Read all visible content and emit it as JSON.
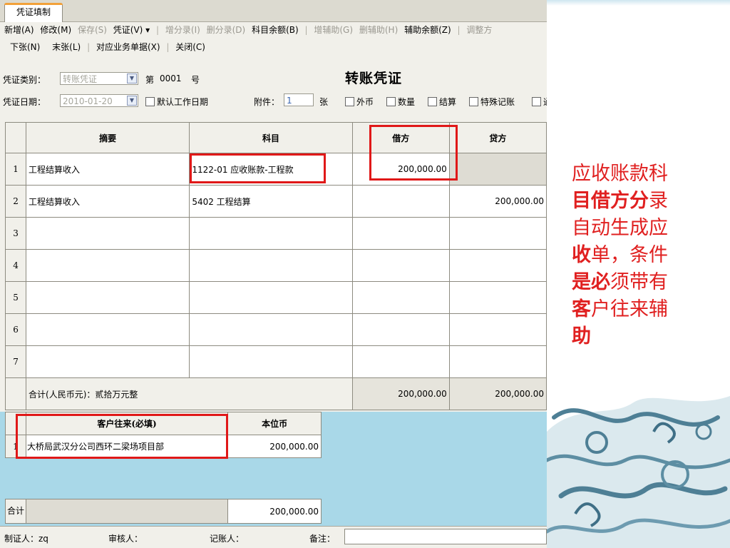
{
  "tab": {
    "label": "凭证填制"
  },
  "menu1": [
    {
      "label": "新增(A)",
      "enabled": true
    },
    {
      "label": "修改(M)",
      "enabled": true
    },
    {
      "label": "保存(S)",
      "enabled": false
    },
    {
      "label": "凭证(V) ▾",
      "enabled": true
    },
    {
      "label": "增分录(I)",
      "enabled": false
    },
    {
      "label": "删分录(D)",
      "enabled": false
    },
    {
      "label": "科目余额(B)",
      "enabled": true
    },
    {
      "label": "增辅助(G)",
      "enabled": false
    },
    {
      "label": "删辅助(H)",
      "enabled": false
    },
    {
      "label": "辅助余额(Z)",
      "enabled": true
    },
    {
      "label": "调整方",
      "enabled": false
    }
  ],
  "menu2": [
    {
      "label": "下张(N)"
    },
    {
      "label": "末张(L)"
    },
    {
      "label": "对应业务单据(X)"
    },
    {
      "label": "关闭(C)"
    }
  ],
  "form": {
    "type_label": "凭证类别：",
    "type_value": "转账凭证",
    "no_prefix": "第",
    "no_value": "0001",
    "no_suffix": "号",
    "title": "转账凭证",
    "date_label": "凭证日期：",
    "date_value": "2010-01-20",
    "default_date": "默认工作日期",
    "attach_label": "附件：",
    "attach_value": "1",
    "attach_unit": "张",
    "checks": [
      "外币",
      "数量",
      "结算",
      "特殊记账",
      "通"
    ]
  },
  "voucher": {
    "headers": {
      "summary": "摘要",
      "account": "科目",
      "debit": "借方",
      "credit": "贷方"
    },
    "rows": [
      {
        "no": "1",
        "summary": "工程结算收入",
        "account": "1122-01 应收账款-工程款",
        "debit": "200,000.00",
        "credit": ""
      },
      {
        "no": "2",
        "summary": "工程结算收入",
        "account": "5402 工程结算",
        "debit": "",
        "credit": "200,000.00"
      },
      {
        "no": "3",
        "summary": "",
        "account": "",
        "debit": "",
        "credit": ""
      },
      {
        "no": "4",
        "summary": "",
        "account": "",
        "debit": "",
        "credit": ""
      },
      {
        "no": "5",
        "summary": "",
        "account": "",
        "debit": "",
        "credit": ""
      },
      {
        "no": "6",
        "summary": "",
        "account": "",
        "debit": "",
        "credit": ""
      },
      {
        "no": "7",
        "summary": "",
        "account": "",
        "debit": "",
        "credit": ""
      }
    ],
    "total_label": "合计(人民币元)：贰拾万元整",
    "total_debit": "200,000.00",
    "total_credit": "200,000.00"
  },
  "aux": {
    "headers": {
      "customer": "客户往来(必填)",
      "amount": "本位币"
    },
    "rows": [
      {
        "no": "1",
        "customer": "大桥局武汉分公司西环二梁场项目部",
        "amount": "200,000.00"
      }
    ],
    "total_label": "合计",
    "total_amount": "200,000.00"
  },
  "status": {
    "maker": "制证人：zq",
    "auditor": "审核人：",
    "poster": "记账人：",
    "memo_label": "备注："
  },
  "annotation": {
    "p1": "应收账款科",
    "p2a": "目",
    "p2b": "借方分",
    "p2c": "录",
    "p3": "自动生成应",
    "p4a": "收",
    "p4b": "单，条件",
    "p5a": "是必",
    "p5b": "须带有",
    "p6a": "客",
    "p6b": "户往来辅",
    "p7": "助"
  },
  "colors": {
    "highlight": "#e01818",
    "note": "#e02020",
    "lower_bg": "#a9d8e8"
  }
}
